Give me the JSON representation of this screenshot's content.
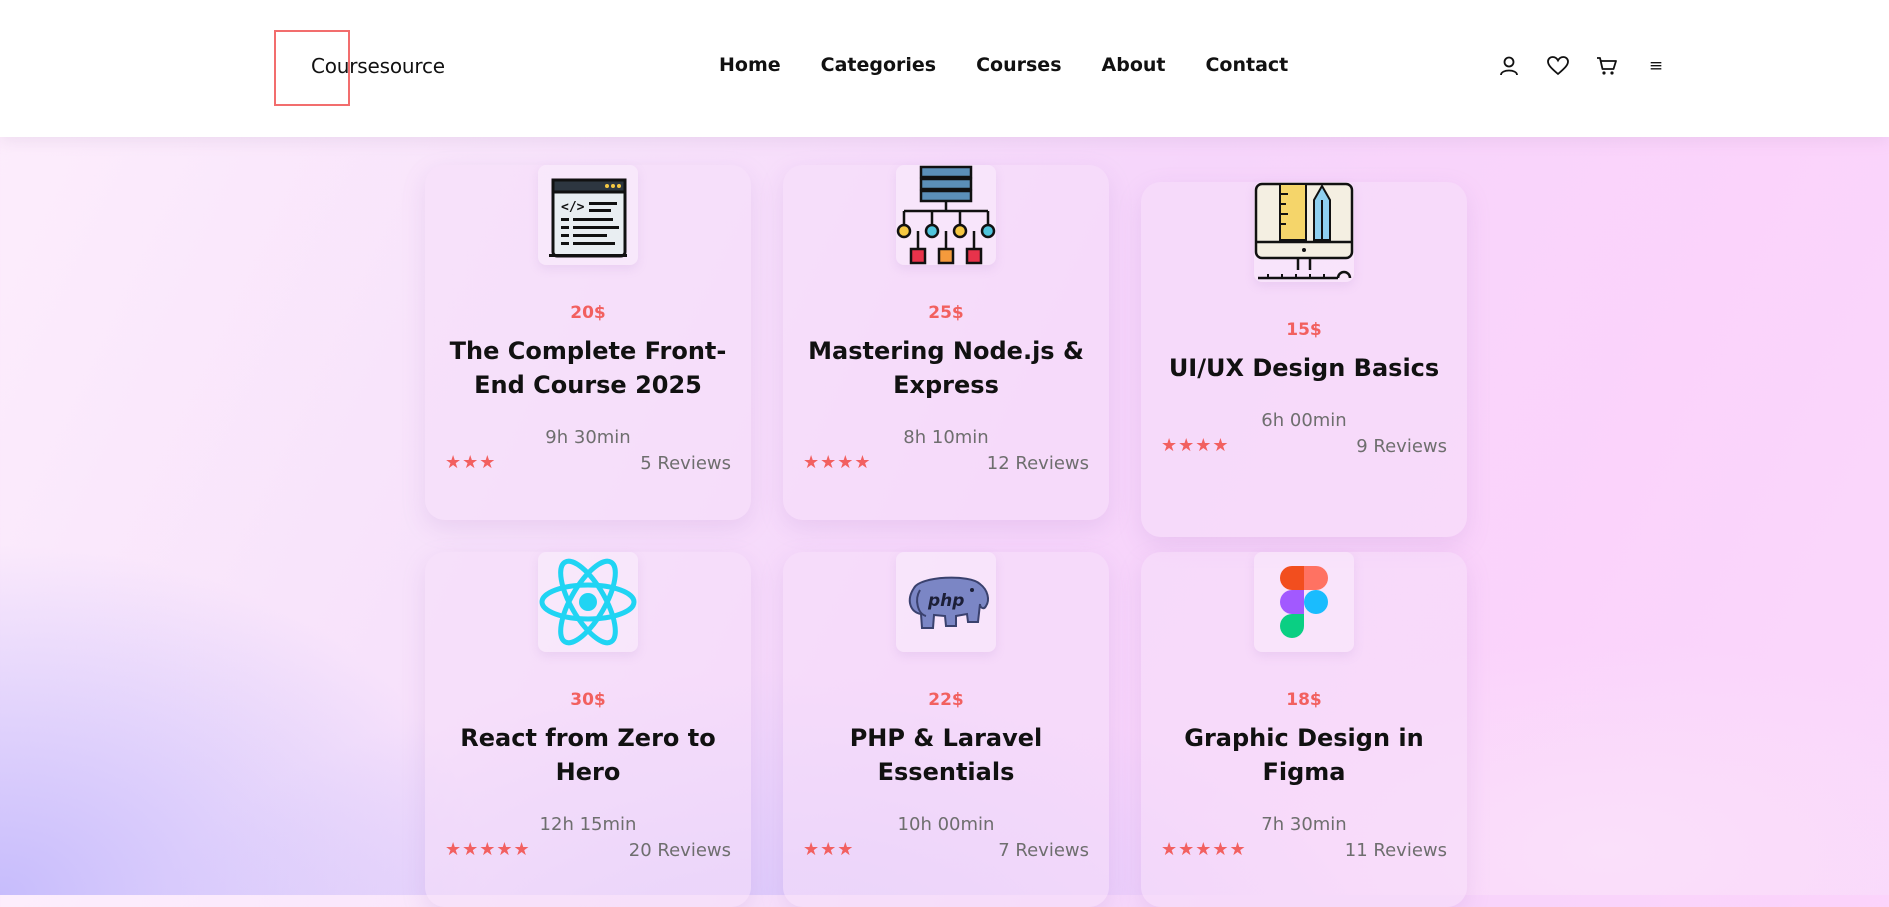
{
  "brand": {
    "name": "Coursesource",
    "accent": "#f26d6d"
  },
  "nav": {
    "items": [
      "Home",
      "Categories",
      "Courses",
      "About",
      "Contact"
    ]
  },
  "header_icons": [
    "user-icon",
    "heart-icon",
    "cart-icon",
    "menu-icon"
  ],
  "menu_glyph": "≡",
  "colors": {
    "price": "#f2605f",
    "stars": "#f26060",
    "text": "#111111",
    "muted": "#6e6e6e"
  },
  "courses": [
    {
      "icon": "code-editor-icon",
      "price": "20$",
      "title": "The Complete Front-End Course 2025",
      "duration": "9h 30min",
      "stars": 3,
      "stars_text": "★★★",
      "reviews": "5 Reviews"
    },
    {
      "icon": "server-network-icon",
      "price": "25$",
      "title": "Mastering Node.js & Express",
      "duration": "8h 10min",
      "stars": 4,
      "stars_text": "★★★★",
      "reviews": "12 Reviews"
    },
    {
      "icon": "design-monitor-icon",
      "price": "15$",
      "title": "UI/UX Design Basics",
      "duration": "6h 00min",
      "stars": 4,
      "stars_text": "★★★★",
      "reviews": "9 Reviews"
    },
    {
      "icon": "react-logo-icon",
      "price": "30$",
      "title": "React from Zero to Hero",
      "duration": "12h 15min",
      "stars": 5,
      "stars_text": "★★★★★",
      "reviews": "20 Reviews"
    },
    {
      "icon": "php-elephant-icon",
      "price": "22$",
      "title": "PHP & Laravel Essentials",
      "duration": "10h 00min",
      "stars": 3,
      "stars_text": "★★★",
      "reviews": "7 Reviews"
    },
    {
      "icon": "figma-logo-icon",
      "price": "18$",
      "title": "Graphic Design in Figma",
      "duration": "7h 30min",
      "stars": 5,
      "stars_text": "★★★★★",
      "reviews": "11 Reviews"
    }
  ]
}
